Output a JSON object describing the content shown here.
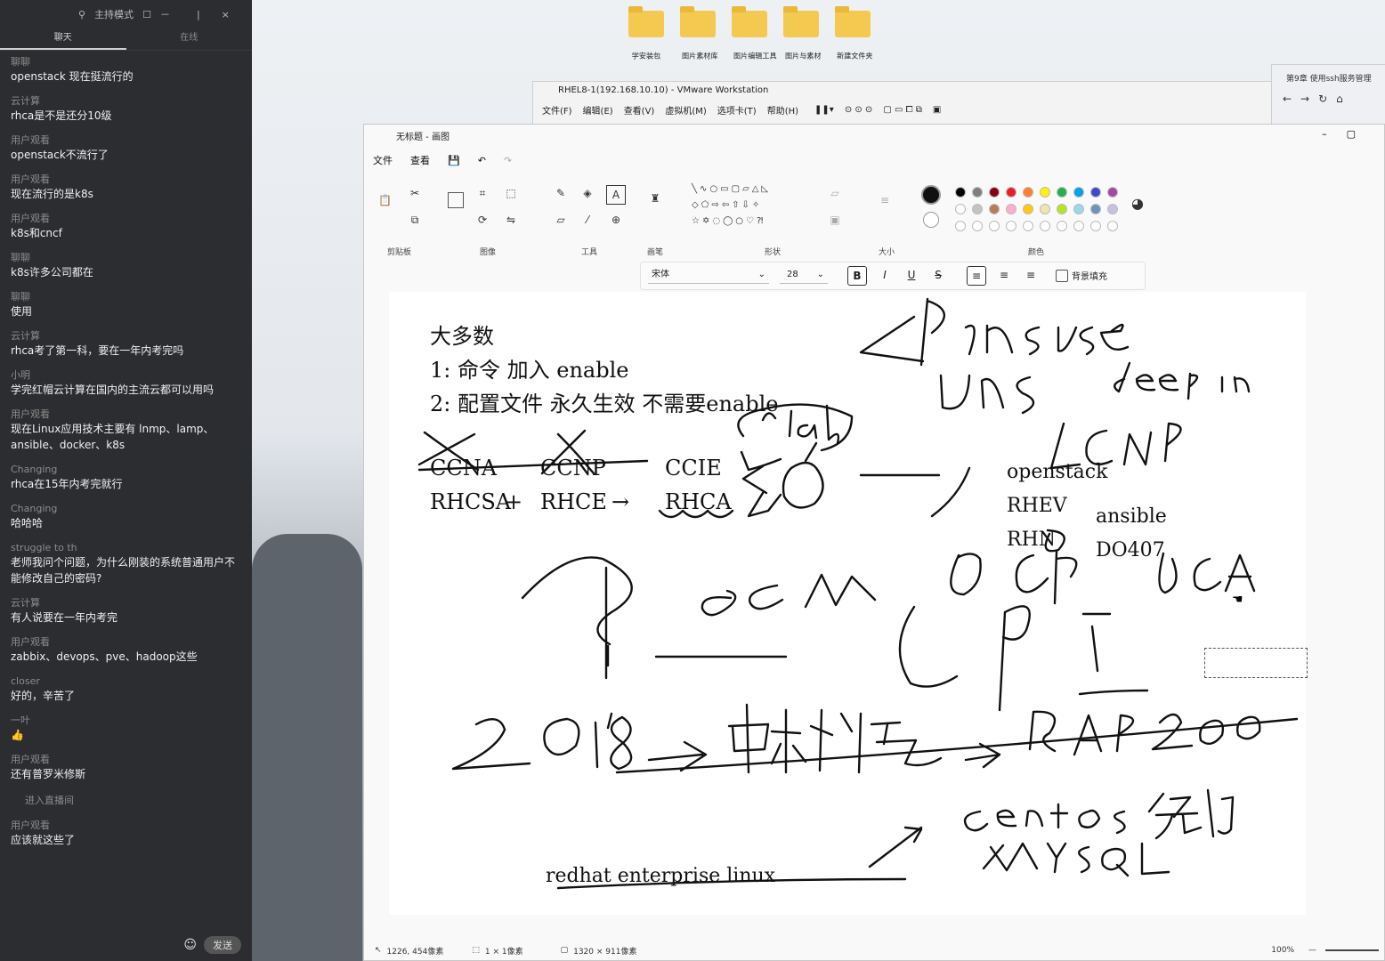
{
  "chat": {
    "top_mode": "主持模式",
    "tabs": [
      "聊天",
      "在线"
    ],
    "messages": [
      {
        "nick": "聊聊",
        "text": "openstack 现在挺流行的"
      },
      {
        "nick": "云计算",
        "text": "rhca是不是还分10级"
      },
      {
        "nick": "用户观看",
        "text": "openstack不流行了"
      },
      {
        "nick": "用户观看",
        "text": "现在流行的是k8s"
      },
      {
        "nick": "用户观看",
        "text": "k8s和cncf"
      },
      {
        "nick": "聊聊",
        "text": "k8s许多公司都在"
      },
      {
        "nick": "聊聊",
        "text": "使用"
      },
      {
        "nick": "云计算",
        "text": "rhca考了第一科，要在一年内考完吗"
      },
      {
        "nick": "小明",
        "text": "学完红帽云计算在国内的主流云都可以用吗"
      },
      {
        "nick": "用户观看",
        "text": "现在Linux应用技术主要有 lnmp、lamp、ansible、docker、k8s"
      },
      {
        "nick": "Changing",
        "text": "rhca在15年内考完就行"
      },
      {
        "nick": "Changing",
        "text": "哈哈哈"
      },
      {
        "nick": "struggle to th",
        "text": "老师我问个问题，为什么刚装的系统普通用户不能修改自己的密码?"
      },
      {
        "nick": "云计算",
        "text": "有人说要在一年内考完"
      },
      {
        "nick": "用户观看",
        "text": "zabbix、devops、pve、hadoop这些"
      },
      {
        "nick": "closer",
        "text": "好的，辛苦了"
      },
      {
        "nick": "一叶",
        "text": "👍"
      },
      {
        "nick": "用户观看",
        "text": "还有普罗米修斯"
      },
      {
        "nick": "",
        "text": "进入直播间"
      },
      {
        "nick": "用户观看",
        "text": "应该就这些了"
      }
    ],
    "send_label": "发送"
  },
  "desktop": {
    "icons": [
      "学安装包",
      "图片素材库",
      "图片编辑工具",
      "图片与素材",
      "新建文件夹"
    ]
  },
  "vmware": {
    "title": "RHEL8-1(192.168.10.10) - VMware Workstation",
    "menu": [
      "文件(F)",
      "编辑(E)",
      "查看(V)",
      "虚拟机(M)",
      "选项卡(T)",
      "帮助(H)"
    ]
  },
  "browser": {
    "tab": "第9章 使用ssh服务管理"
  },
  "paint": {
    "title": "无标题 - 画图",
    "menu": [
      "文件",
      "查看"
    ],
    "groups": [
      "剪贴板",
      "图像",
      "工具",
      "画笔",
      "形状",
      "大小",
      "颜色"
    ],
    "font": "宋体",
    "font_size": "28",
    "bg_fill_label": "背景填充",
    "status_cursor": "1226, 454像素",
    "status_selection": "1 × 1像素",
    "status_canvas": "1320 × 911像素",
    "zoom": "100%",
    "palette_row1": [
      "#000000",
      "#7f7f7f",
      "#880015",
      "#ed1c24",
      "#ff7f27",
      "#fff200",
      "#22b14c",
      "#00a2e8",
      "#3f48cc",
      "#a349a4"
    ],
    "palette_row2": [
      "#ffffff",
      "#c3c3c3",
      "#b97a57",
      "#ffaec9",
      "#ffc90e",
      "#efe4b0",
      "#b5e61d",
      "#99d9ea",
      "#7092be",
      "#c8bfe7"
    ]
  },
  "canvas_text": {
    "line0": "大多数",
    "line1": "1: 命令 加入 enable",
    "line2": "2: 配置文件 永久生效  不需要enable",
    "ccna": "CCNA",
    "ccnp": "CCNP",
    "ccie": "CCIE",
    "rhcsa": "RHCSA",
    "plus": "+",
    "rhce": "RHCE",
    "arrow": "→",
    "rhca": "RHCA",
    "openstack": "openstack",
    "rhev": "RHEV",
    "rhn": "RHN",
    "ansible": "ansible",
    "do407": "DO407",
    "redhat": "redhat enterprise linux"
  }
}
